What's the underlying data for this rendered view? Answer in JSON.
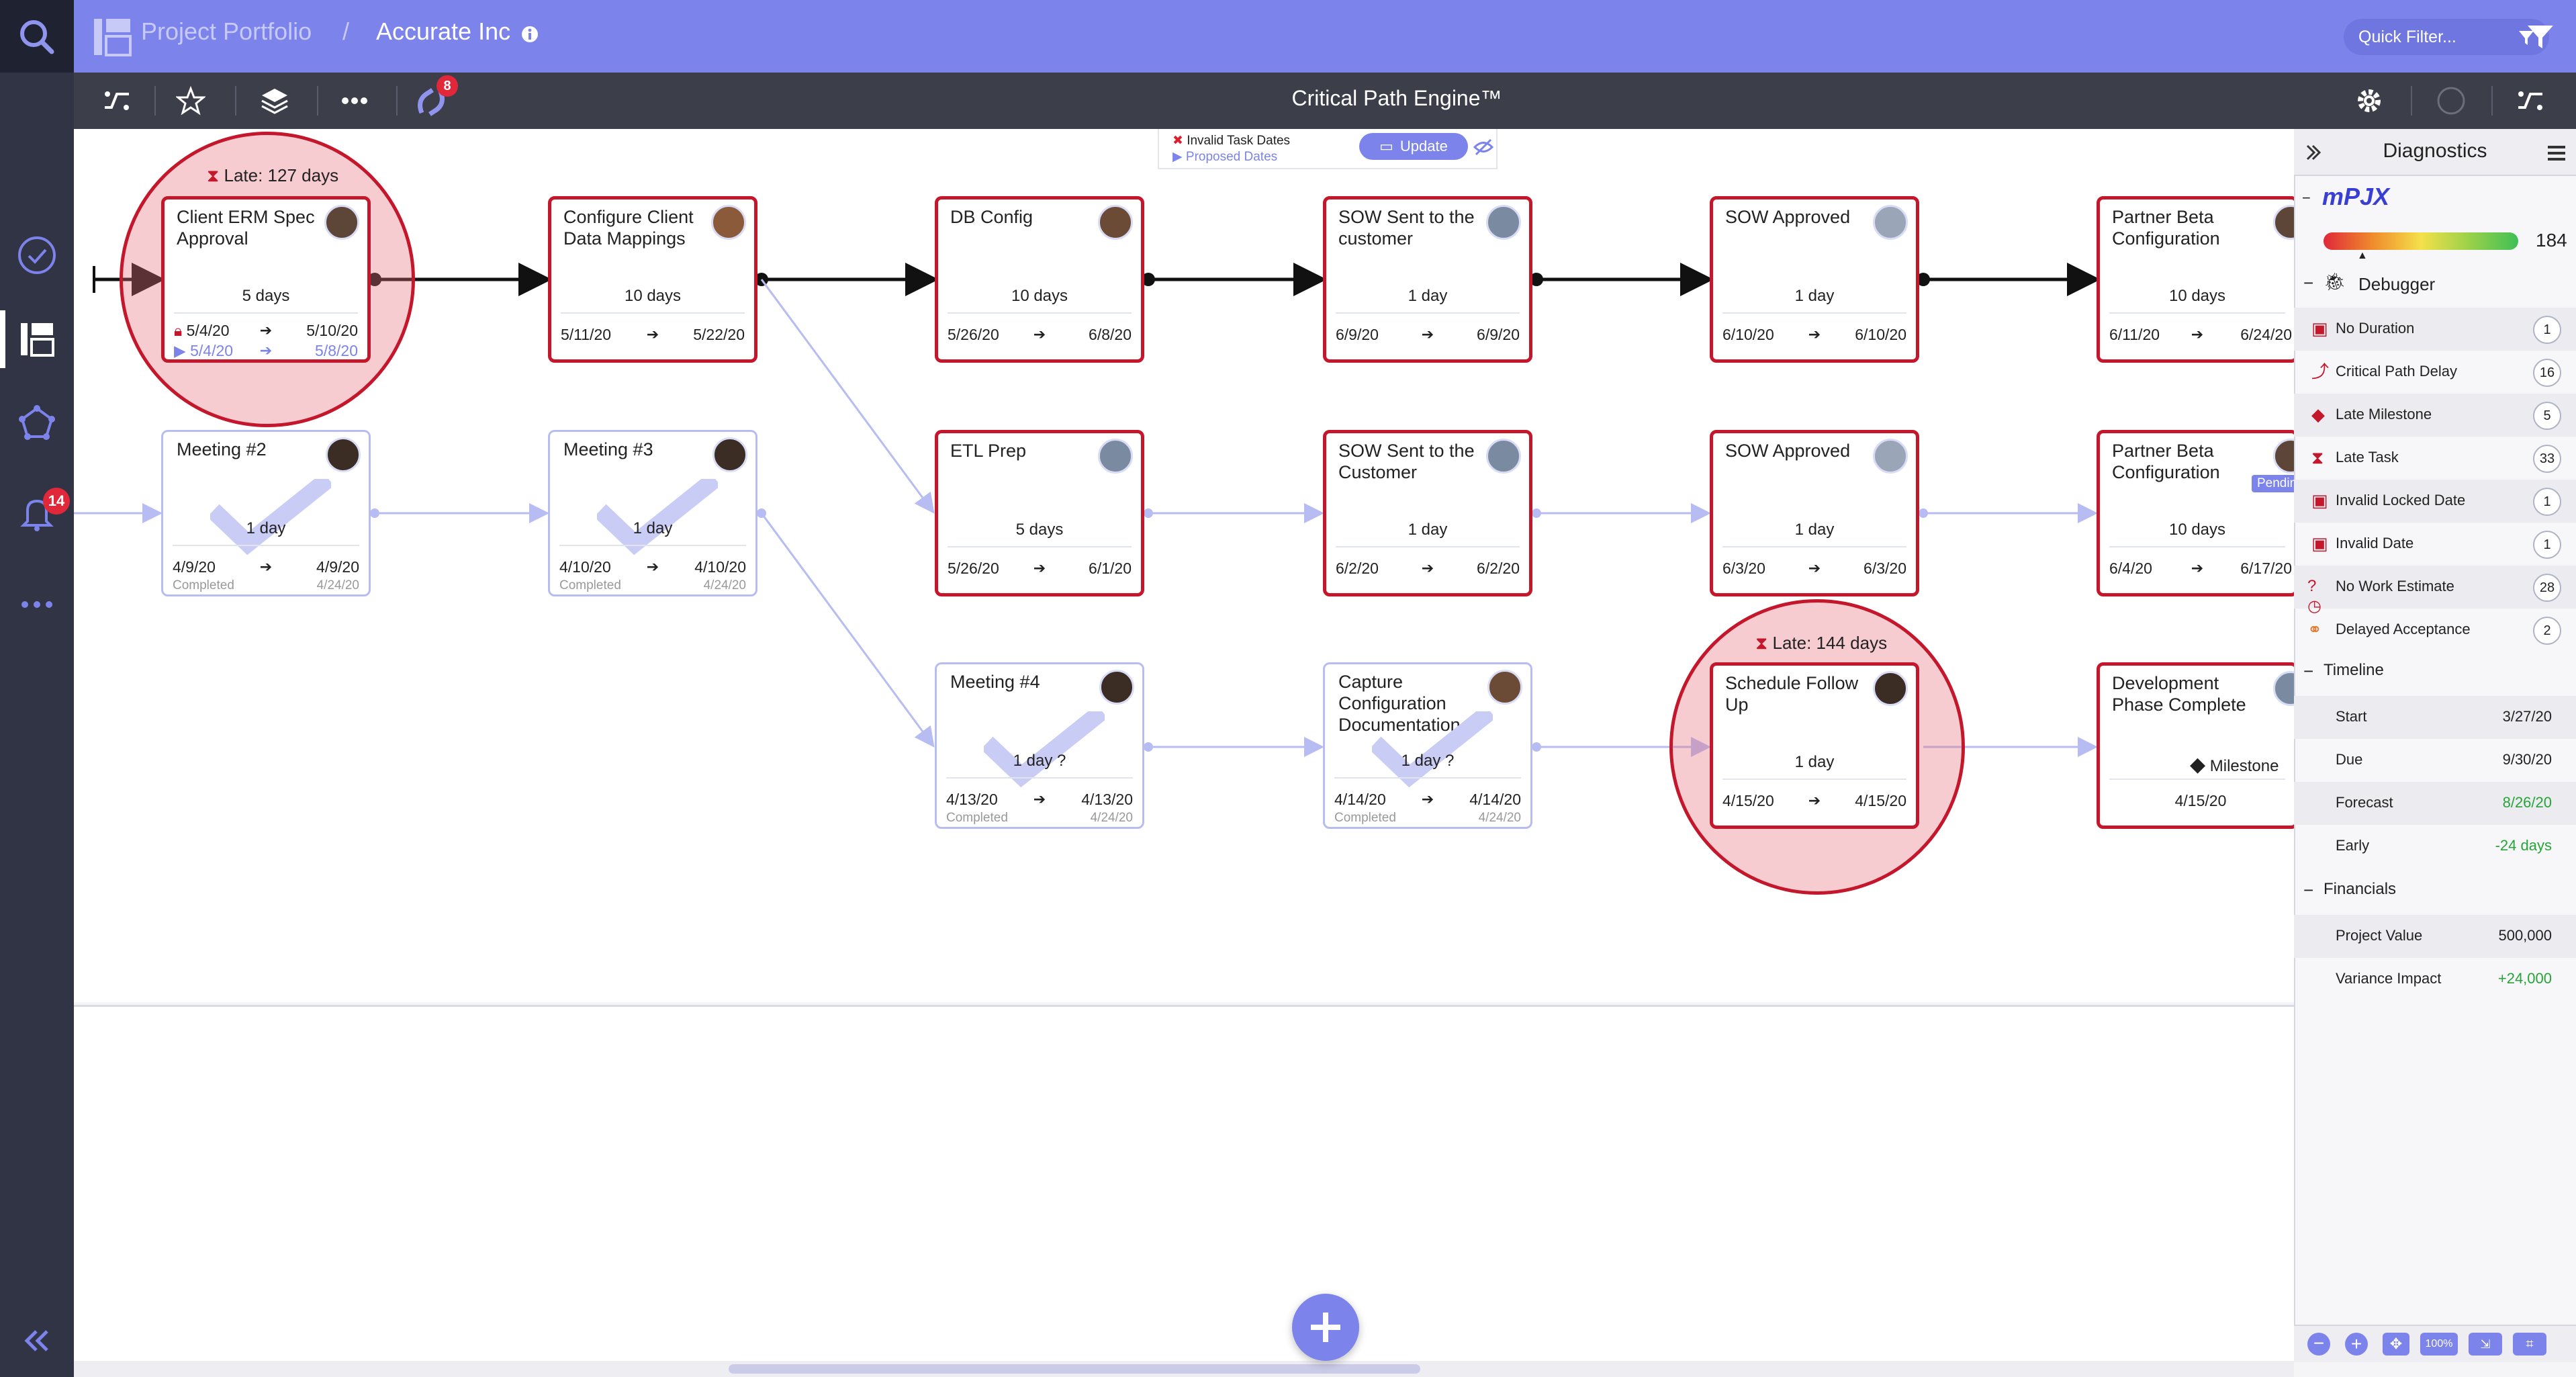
{
  "app": {
    "breadcrumb_root": "Project Portfolio",
    "breadcrumb_sep": "/",
    "project_name": "Accurate Inc",
    "quick_filter_placeholder": "Quick Filter...",
    "engine_title": "Critical Path Engine™",
    "toolbar_badge": "8",
    "notification_count": "14",
    "accent": "#7c83ea"
  },
  "legend": {
    "invalid_label": "Invalid Task Dates",
    "proposed_label": "Proposed Dates",
    "update_label": "Update"
  },
  "tasks": {
    "client_erm": {
      "title": "Client ERM Spec Approval",
      "duration": "5 days",
      "start": "5/4/20",
      "end": "5/10/20",
      "pstart": "5/4/20",
      "pend": "5/8/20",
      "late": "Late: 127 days"
    },
    "configure_client": {
      "title": "Configure Client Data Mappings",
      "duration": "10 days",
      "start": "5/11/20",
      "end": "5/22/20"
    },
    "db_config": {
      "title": "DB Config",
      "duration": "10 days",
      "start": "5/26/20",
      "end": "6/8/20"
    },
    "sow_sent_1": {
      "title": "SOW Sent to the customer",
      "duration": "1 day",
      "start": "6/9/20",
      "end": "6/9/20"
    },
    "sow_approved_1": {
      "title": "SOW Approved",
      "duration": "1 day",
      "start": "6/10/20",
      "end": "6/10/20"
    },
    "partner_beta_1": {
      "title": "Partner Beta Configuration",
      "duration": "10 days",
      "start": "6/11/20",
      "end": "6/24/20"
    },
    "meeting_2": {
      "title": "Meeting #2",
      "duration": "1 day",
      "start": "4/9/20",
      "end": "4/9/20",
      "status": "Completed",
      "completed": "4/24/20"
    },
    "meeting_3": {
      "title": "Meeting #3",
      "duration": "1 day",
      "start": "4/10/20",
      "end": "4/10/20",
      "status": "Completed",
      "completed": "4/24/20"
    },
    "etl_prep": {
      "title": "ETL Prep",
      "duration": "5 days",
      "start": "5/26/20",
      "end": "6/1/20"
    },
    "sow_sent_2": {
      "title": "SOW Sent to the Customer",
      "duration": "1 day",
      "start": "6/2/20",
      "end": "6/2/20"
    },
    "sow_approved_2": {
      "title": "SOW Approved",
      "duration": "1 day",
      "start": "6/3/20",
      "end": "6/3/20"
    },
    "partner_beta_2": {
      "title": "Partner Beta Configuration",
      "duration": "10 days",
      "start": "6/4/20",
      "end": "6/17/20",
      "tag": "Pending"
    },
    "meeting_4": {
      "title": "Meeting #4",
      "duration": "1 day ?",
      "start": "4/13/20",
      "end": "4/13/20",
      "status": "Completed",
      "completed": "4/24/20"
    },
    "capture_config": {
      "title": "Capture Configuration Documentation",
      "duration": "1 day ?",
      "start": "4/14/20",
      "end": "4/14/20",
      "status": "Completed",
      "completed": "4/24/20"
    },
    "schedule_follow": {
      "title": "Schedule Follow Up",
      "duration": "1 day",
      "start": "4/15/20",
      "end": "4/15/20",
      "late": "Late: 144 days"
    },
    "dev_phase": {
      "title": "Development Phase Complete",
      "milestone": "Milestone",
      "date": "4/15/20"
    }
  },
  "diagnostics": {
    "title": "Diagnostics",
    "brand": "mPJX",
    "score": "184",
    "debugger_label": "Debugger",
    "items": [
      {
        "label": "No Duration",
        "count": "1"
      },
      {
        "label": "Critical Path Delay",
        "count": "16"
      },
      {
        "label": "Late Milestone",
        "count": "5"
      },
      {
        "label": "Late Task",
        "count": "33"
      },
      {
        "label": "Invalid Locked Date",
        "count": "1"
      },
      {
        "label": "Invalid Date",
        "count": "1"
      },
      {
        "label": "No Work Estimate",
        "count": "28"
      },
      {
        "label": "Delayed Acceptance",
        "count": "2"
      }
    ],
    "timeline_label": "Timeline",
    "timeline": [
      {
        "label": "Start",
        "value": "3/27/20"
      },
      {
        "label": "Due",
        "value": "9/30/20"
      },
      {
        "label": "Forecast",
        "value": "8/26/20"
      },
      {
        "label": "Early",
        "value": "-24 days"
      }
    ],
    "financials_label": "Financials",
    "financials": [
      {
        "label": "Project Value",
        "value": "500,000"
      },
      {
        "label": "Variance Impact",
        "value": "+24,000"
      }
    ],
    "zoom_label": "100%"
  }
}
